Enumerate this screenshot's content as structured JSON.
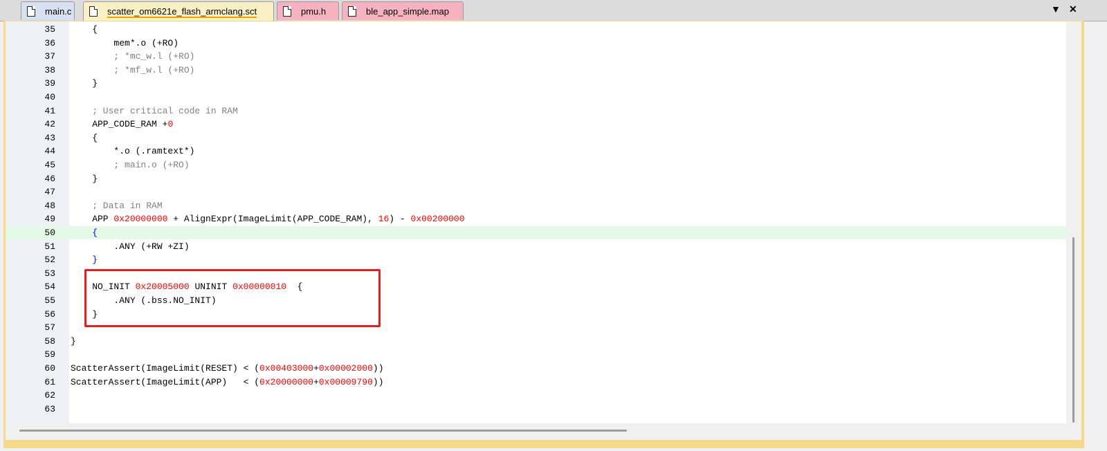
{
  "tabs": [
    {
      "label": "main.c"
    },
    {
      "label": "scatter_om6621e_flash_armclang.sct"
    },
    {
      "label": "pmu.h"
    },
    {
      "label": "ble_app_simple.map"
    }
  ],
  "window": {
    "dropdown_icon": "▼",
    "close_icon": "✕"
  },
  "colors": {
    "comment": "#808080",
    "number": "#ff0000",
    "brace": "#0000ff",
    "highlight": "#e4fae7",
    "box": "#e61e1e"
  },
  "lines": [
    {
      "n": "35",
      "parts": [
        [
          "t",
          "    {"
        ]
      ]
    },
    {
      "n": "36",
      "parts": [
        [
          "t",
          "        mem*.o (+RO)"
        ]
      ]
    },
    {
      "n": "37",
      "parts": [
        [
          "c",
          "        ; *mc_w.l (+RO)"
        ]
      ]
    },
    {
      "n": "38",
      "parts": [
        [
          "c",
          "        ; *mf_w.l (+RO)"
        ]
      ]
    },
    {
      "n": "39",
      "parts": [
        [
          "t",
          "    }"
        ]
      ]
    },
    {
      "n": "40",
      "parts": []
    },
    {
      "n": "41",
      "parts": [
        [
          "c",
          "    ; User critical code in RAM"
        ]
      ]
    },
    {
      "n": "42",
      "parts": [
        [
          "t",
          "    APP_CODE_RAM +"
        ],
        [
          "n",
          "0"
        ]
      ]
    },
    {
      "n": "43",
      "parts": [
        [
          "t",
          "    {"
        ]
      ]
    },
    {
      "n": "44",
      "parts": [
        [
          "t",
          "        *.o (.ramtext*)"
        ]
      ]
    },
    {
      "n": "45",
      "parts": [
        [
          "c",
          "        ; main.o (+RO)"
        ]
      ]
    },
    {
      "n": "46",
      "parts": [
        [
          "t",
          "    }"
        ]
      ]
    },
    {
      "n": "47",
      "parts": []
    },
    {
      "n": "48",
      "parts": [
        [
          "c",
          "    ; Data in RAM"
        ]
      ]
    },
    {
      "n": "49",
      "parts": [
        [
          "t",
          "    APP "
        ],
        [
          "n",
          "0x20000000"
        ],
        [
          "t",
          " + AlignExpr(ImageLimit(APP_CODE_RAM), "
        ],
        [
          "n",
          "16"
        ],
        [
          "t",
          ") - "
        ],
        [
          "n",
          "0x00200000"
        ]
      ]
    },
    {
      "n": "50",
      "parts": [
        [
          "b",
          "    {"
        ]
      ],
      "highlight": true
    },
    {
      "n": "51",
      "parts": [
        [
          "t",
          "        .ANY (+RW +ZI)"
        ]
      ]
    },
    {
      "n": "52",
      "parts": [
        [
          "b",
          "    }"
        ]
      ]
    },
    {
      "n": "53",
      "parts": []
    },
    {
      "n": "54",
      "parts": [
        [
          "t",
          "    NO_INIT "
        ],
        [
          "n",
          "0x20005000"
        ],
        [
          "t",
          " UNINIT "
        ],
        [
          "n",
          "0x00000010"
        ],
        [
          "t",
          "  {"
        ]
      ]
    },
    {
      "n": "55",
      "parts": [
        [
          "t",
          "        .ANY (.bss.NO_INIT)"
        ]
      ]
    },
    {
      "n": "56",
      "parts": [
        [
          "t",
          "    }"
        ]
      ]
    },
    {
      "n": "57",
      "parts": []
    },
    {
      "n": "58",
      "parts": [
        [
          "t",
          "}"
        ]
      ]
    },
    {
      "n": "59",
      "parts": []
    },
    {
      "n": "60",
      "parts": [
        [
          "t",
          "ScatterAssert(ImageLimit(RESET) < ("
        ],
        [
          "n",
          "0x00403000"
        ],
        [
          "t",
          "+"
        ],
        [
          "n",
          "0x00002000"
        ],
        [
          "t",
          "))"
        ]
      ]
    },
    {
      "n": "61",
      "parts": [
        [
          "t",
          "ScatterAssert(ImageLimit(APP)   < ("
        ],
        [
          "n",
          "0x20000000"
        ],
        [
          "t",
          "+"
        ],
        [
          "n",
          "0x00009790"
        ],
        [
          "t",
          "))"
        ]
      ]
    },
    {
      "n": "62",
      "parts": []
    },
    {
      "n": "63",
      "parts": []
    }
  ]
}
